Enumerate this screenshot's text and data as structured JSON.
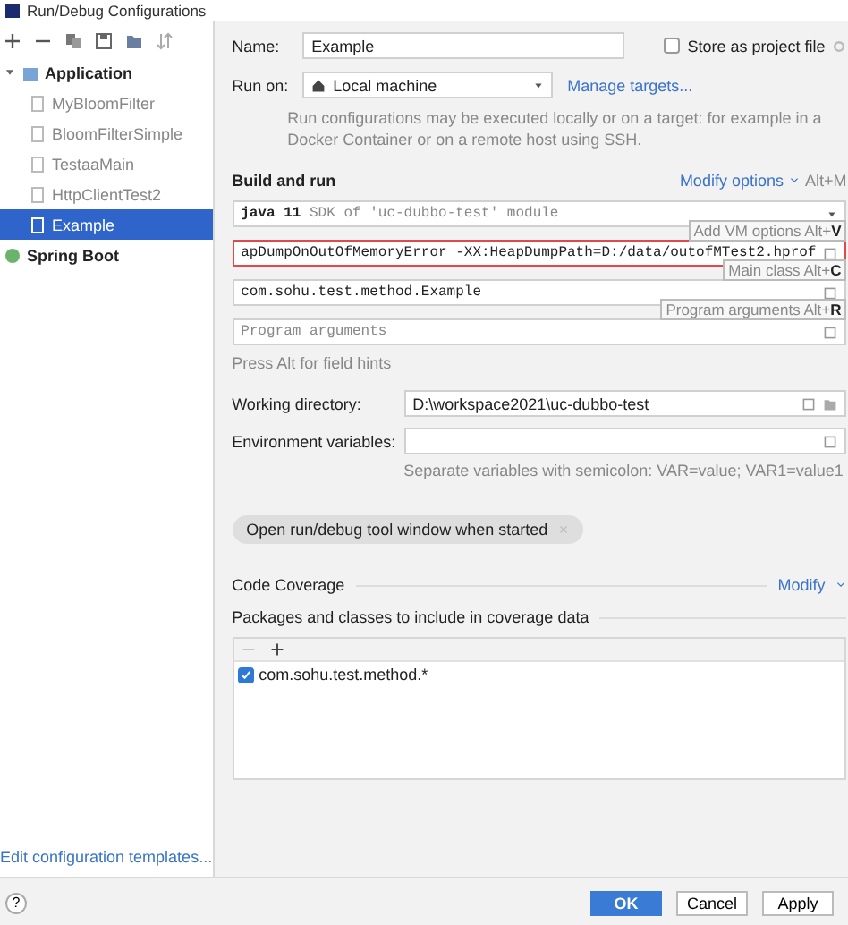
{
  "window": {
    "title": "Run/Debug Configurations"
  },
  "sidebar": {
    "tree": [
      {
        "label": "Application",
        "selected": false,
        "children": [
          {
            "label": "MyBloomFilter",
            "selected": false
          },
          {
            "label": "BloomFilterSimple",
            "selected": false
          },
          {
            "label": "TestaaMain",
            "selected": false
          },
          {
            "label": "HttpClientTest2",
            "selected": false
          },
          {
            "label": "Example",
            "selected": true
          }
        ]
      },
      {
        "label": "Spring Boot",
        "selected": false
      }
    ],
    "footer_link": "Edit configuration templates..."
  },
  "form": {
    "name": {
      "label": "Name:",
      "value": "Example"
    },
    "store_as_project_file": {
      "label": "Store as project file",
      "checked": false
    },
    "run_on": {
      "label": "Run on:",
      "value": "Local machine"
    },
    "manage_targets": "Manage targets...",
    "run_on_description": "Run configurations may be executed locally or on a target: for example in a Docker Container or on a remote host using SSH.",
    "build_and_run": {
      "title": "Build and run",
      "modify_options": "Modify options",
      "shortcut": "Alt+M",
      "fields": [
        {
          "kind": "sdk",
          "value": "java 11",
          "hint": "SDK of 'uc-dubbo-test' module"
        },
        {
          "kind": "text",
          "value": "apDumpOnOutOfMemoryError -XX:HeapDumpPath=D:/data/outofMTest2.hprof",
          "highlighted": true,
          "tooltip": "Add VM options Alt+**V**"
        },
        {
          "kind": "text",
          "value": "com.sohu.test.method.Example",
          "highlighted": false,
          "tooltip": "Main class Alt+**C**"
        },
        {
          "kind": "text",
          "placeholder": "Program arguments",
          "highlighted": false,
          "tooltip": "Program arguments Alt+**R**"
        }
      ],
      "field_hint": "Press Alt for field hints"
    },
    "working_directory": {
      "label": "Working directory:",
      "value": "D:\\workspace2021\\uc-dubbo-test"
    },
    "environment_variables": {
      "label": "Environment variables:",
      "hint": "Separate variables with semicolon: VAR=value; VAR1=value1"
    },
    "option_chip": "Open run/debug tool window when started",
    "code_coverage": {
      "title": "Code Coverage",
      "modify": "Modify",
      "packages_title": "Packages and classes to include in coverage data",
      "items": [
        {
          "label": "com.sohu.test.method.*",
          "checked": true
        }
      ]
    }
  },
  "buttons": [
    {
      "label": "OK",
      "kind": "primary"
    },
    {
      "label": "Cancel",
      "kind": "normal"
    },
    {
      "label": "Apply",
      "kind": "normal"
    }
  ],
  "help": "?"
}
